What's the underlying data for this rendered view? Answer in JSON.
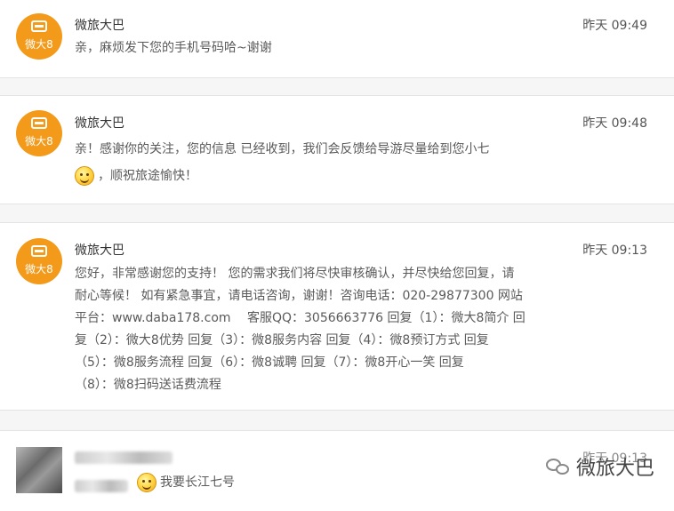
{
  "messages": [
    {
      "sender": "微旅大巴",
      "avatar_text": "微大8",
      "time": "昨天 09:49",
      "text": "亲，麻烦发下您的手机号码哈~谢谢"
    },
    {
      "sender": "微旅大巴",
      "avatar_text": "微大8",
      "time": "昨天 09:48",
      "text_line1": "亲！感谢你的关注，您的信息 已经收到，我们会反馈给导游尽量给到您小七",
      "text_line2": "，顺祝旅途愉快！"
    },
    {
      "sender": "微旅大巴",
      "avatar_text": "微大8",
      "time": "昨天 09:13",
      "lines": [
        "您好，非常感谢您的支持！ 您的需求我们将尽快审核确认，并尽快给您回复，请",
        "耐心等候！ 如有紧急事宜，请电话咨询，谢谢！咨询电话：020-29877300 网站",
        "平台：www.daba178.com　 客服QQ：3056663776 回复（1）：微大8简介 回",
        "复（2）：微大8优势 回复（3）：微8服务内容 回复（4）：微8预订方式 回复",
        "（5）：微8服务流程 回复（6）：微8诚聘 回复（7）：微8开心一笑 回复",
        "（8）：微8扫码送话费流程"
      ]
    },
    {
      "time": "昨天 09:13",
      "text": "我要长江七号"
    }
  ],
  "watermark": {
    "text": "微旅大巴",
    "icon": "wechat-icon"
  },
  "colors": {
    "avatar_bg": "#f39a1b",
    "page_bg": "#f6f6f6"
  }
}
